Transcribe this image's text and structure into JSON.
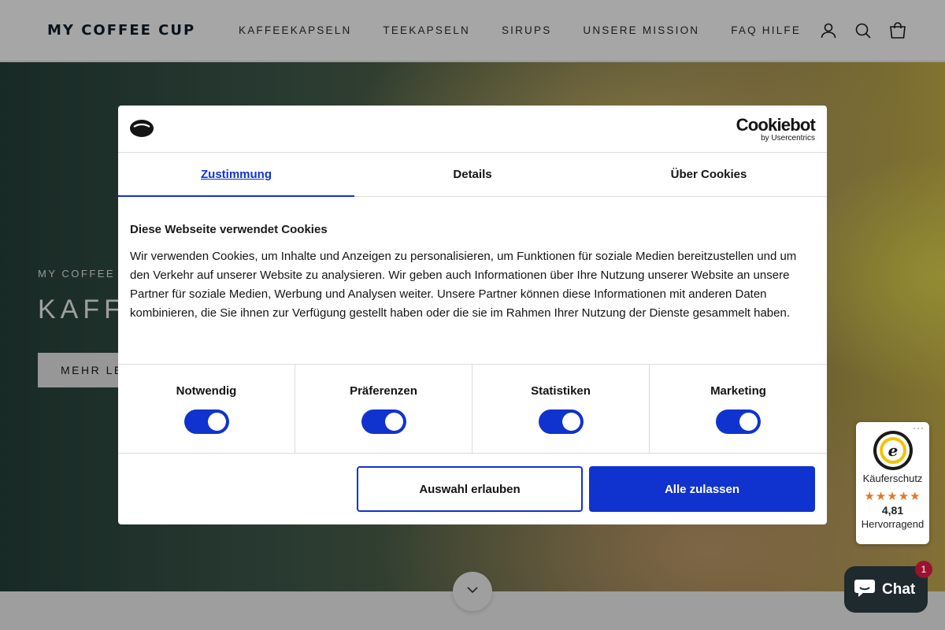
{
  "header": {
    "logo": "MY COFFEE CUP",
    "nav": [
      "KAFFEEKAPSELN",
      "TEEKAPSELN",
      "SIRUPS",
      "UNSERE MISSION",
      "FAQ HILFE"
    ],
    "icons": [
      "account-icon",
      "search-icon",
      "cart-icon"
    ]
  },
  "hero": {
    "eyebrow": "MY COFFEE C",
    "title": "KAFF",
    "button": "MEHR LE",
    "scroll_icon": "chevron-down-icon"
  },
  "cookie_dialog": {
    "brand": "Cookiebot",
    "brand_sub": "by Usercentrics",
    "tabs": [
      {
        "label": "Zustimmung",
        "active": true
      },
      {
        "label": "Details",
        "active": false
      },
      {
        "label": "Über Cookies",
        "active": false
      }
    ],
    "heading": "Diese Webseite verwendet Cookies",
    "text": "Wir verwenden Cookies, um Inhalte und Anzeigen zu personalisieren, um Funktionen für soziale Medien bereitzustellen und um den Verkehr auf unserer Website zu analysieren. Wir geben auch Informationen über Ihre Nutzung unserer Website an unsere Partner für soziale Medien, Werbung und Analysen weiter. Unsere Partner können diese Informationen mit anderen Daten kombinieren, die Sie ihnen zur Verfügung gestellt haben oder die sie im Rahmen Ihrer Nutzung der Dienste gesammelt haben.",
    "categories": [
      {
        "label": "Notwendig",
        "on": true
      },
      {
        "label": "Präferenzen",
        "on": true
      },
      {
        "label": "Statistiken",
        "on": true
      },
      {
        "label": "Marketing",
        "on": true
      }
    ],
    "btn_selection": "Auswahl erlauben",
    "btn_all": "Alle zulassen",
    "accent": "#1032cf"
  },
  "trusted_shops": {
    "label": "Käuferschutz",
    "stars": "★★★★★",
    "score": "4,81",
    "rating": "Hervorragend"
  },
  "chat": {
    "label": "Chat",
    "badge": "1"
  }
}
